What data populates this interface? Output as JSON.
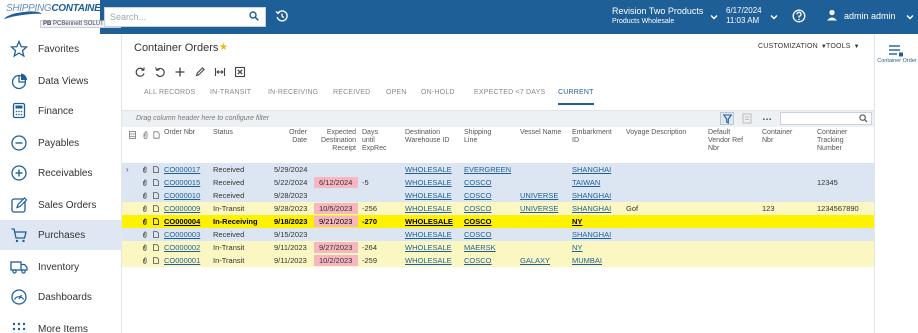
{
  "brand": {
    "logo_top": "SHIPPING",
    "logo_top_bold": "CONTAINER",
    "logo_sub_prefix": "PB",
    "logo_sub": "PCBennett SOLUTIONS"
  },
  "search": {
    "placeholder": "Search..."
  },
  "company": {
    "name": "Revision Two Products",
    "branch": "Products Wholesale"
  },
  "session": {
    "date": "6/17/2024",
    "time": "11:03 AM"
  },
  "user": {
    "name": "admin admin"
  },
  "sidebar": {
    "items": [
      {
        "label": "Favorites",
        "icon": "star-icon"
      },
      {
        "label": "Data Views",
        "icon": "data-views-icon"
      },
      {
        "label": "Finance",
        "icon": "calculator-icon"
      },
      {
        "label": "Payables",
        "icon": "minus-circle-icon"
      },
      {
        "label": "Receivables",
        "icon": "plus-circle-icon"
      },
      {
        "label": "Sales Orders",
        "icon": "edit-icon"
      },
      {
        "label": "Purchases",
        "icon": "cart-icon"
      },
      {
        "label": "Inventory",
        "icon": "truck-icon"
      },
      {
        "label": "Dashboards",
        "icon": "dashboard-icon"
      },
      {
        "label": "More Items",
        "icon": "grid-dots-icon"
      }
    ]
  },
  "page": {
    "title": "Container Orders",
    "customization": "CUSTOMIZATION",
    "tools": "TOOLS"
  },
  "tabs": [
    "ALL RECORDS",
    "IN-TRANSIT",
    "IN-RECEIVING",
    "RECEIVED",
    "OPEN",
    "ON-HOLD",
    "EXPECTED <7 DAYS",
    "CURRENT"
  ],
  "grid": {
    "group_hint": "Drag column header here to configure filter",
    "columns": {
      "order_nbr": "Order Nbr",
      "status": "Status",
      "order_date": [
        "Order",
        "Date"
      ],
      "expected": [
        "Expected",
        "Destination",
        "Receipt"
      ],
      "days": [
        "Days",
        "until",
        "ExpRec"
      ],
      "dest_wh": [
        "Destination",
        "Warehouse ID"
      ],
      "line": [
        "Shipping",
        "Line"
      ],
      "vessel": "Vessel Name",
      "embark": [
        "Embarkment",
        "ID"
      ],
      "voyage": "Voyage Description",
      "vendor_ref": [
        "Default",
        "Vendor Ref",
        "Nbr"
      ],
      "container_nbr": [
        "Container",
        "Nbr"
      ],
      "tracking": [
        "Container",
        "Tracking",
        "Number"
      ]
    },
    "rows": [
      {
        "order_nbr": "CO000017",
        "status": "Received",
        "order_date": "5/29/2024",
        "expected": "",
        "days": "",
        "dest_wh": "WHOLESALE",
        "line": "EVERGREEN",
        "vessel": "",
        "embark": "SHANGHAI",
        "voyage": "",
        "vendor_ref": "",
        "container_nbr": "",
        "tracking": ""
      },
      {
        "order_nbr": "CO000015",
        "status": "Received",
        "order_date": "5/22/2024",
        "expected": "6/12/2024",
        "days": "-5",
        "dest_wh": "WHOLESALE",
        "line": "COSCO",
        "vessel": "",
        "embark": "TAIWAN",
        "voyage": "",
        "vendor_ref": "",
        "container_nbr": "",
        "tracking": "12345"
      },
      {
        "order_nbr": "CO000010",
        "status": "Received",
        "order_date": "9/28/2023",
        "expected": "",
        "days": "",
        "dest_wh": "WHOLESALE",
        "line": "COSCO",
        "vessel": "UNIVERSE",
        "embark": "SHANGHAI",
        "voyage": "",
        "vendor_ref": "",
        "container_nbr": "",
        "tracking": ""
      },
      {
        "order_nbr": "CO000009",
        "status": "In-Transit",
        "order_date": "9/28/2023",
        "expected": "10/5/2023",
        "days": "-256",
        "dest_wh": "WHOLESALE",
        "line": "COSCO",
        "vessel": "UNIVERSE",
        "embark": "SHANGHAI",
        "voyage": "Gof",
        "vendor_ref": "",
        "container_nbr": "123",
        "tracking": "1234567890"
      },
      {
        "order_nbr": "CO000004",
        "status": "In-Receiving",
        "order_date": "9/18/2023",
        "expected": "9/21/2023",
        "days": "-270",
        "dest_wh": "WHOLESALE",
        "line": "COSCO",
        "vessel": "",
        "embark": "NY",
        "voyage": "",
        "vendor_ref": "",
        "container_nbr": "",
        "tracking": ""
      },
      {
        "order_nbr": "CO000003",
        "status": "Received",
        "order_date": "9/15/2023",
        "expected": "",
        "days": "",
        "dest_wh": "WHOLESALE",
        "line": "COSCO",
        "vessel": "",
        "embark": "SHANGHAI",
        "voyage": "",
        "vendor_ref": "",
        "container_nbr": "",
        "tracking": ""
      },
      {
        "order_nbr": "CO000002",
        "status": "In-Transit",
        "order_date": "9/11/2023",
        "expected": "9/27/2023",
        "days": "-264",
        "dest_wh": "WHOLESALE",
        "line": "MAERSK",
        "vessel": "",
        "embark": "NY",
        "voyage": "",
        "vendor_ref": "",
        "container_nbr": "",
        "tracking": ""
      },
      {
        "order_nbr": "CO000001",
        "status": "In-Transit",
        "order_date": "9/11/2023",
        "expected": "10/2/2023",
        "days": "-259",
        "dest_wh": "WHOLESALE",
        "line": "COSCO",
        "vessel": "GALAXY",
        "embark": "MUMBAI",
        "voyage": "",
        "vendor_ref": "",
        "container_nbr": "",
        "tracking": ""
      }
    ]
  },
  "right_panel": {
    "label": "Container Order"
  },
  "colors": {
    "brand_blue": "#1f5f98",
    "received_row": "#dce6f2",
    "in_transit_row": "#fbf7c2",
    "in_receiving_row": "#fff200",
    "overdue_cell": "#f8b6c0"
  }
}
